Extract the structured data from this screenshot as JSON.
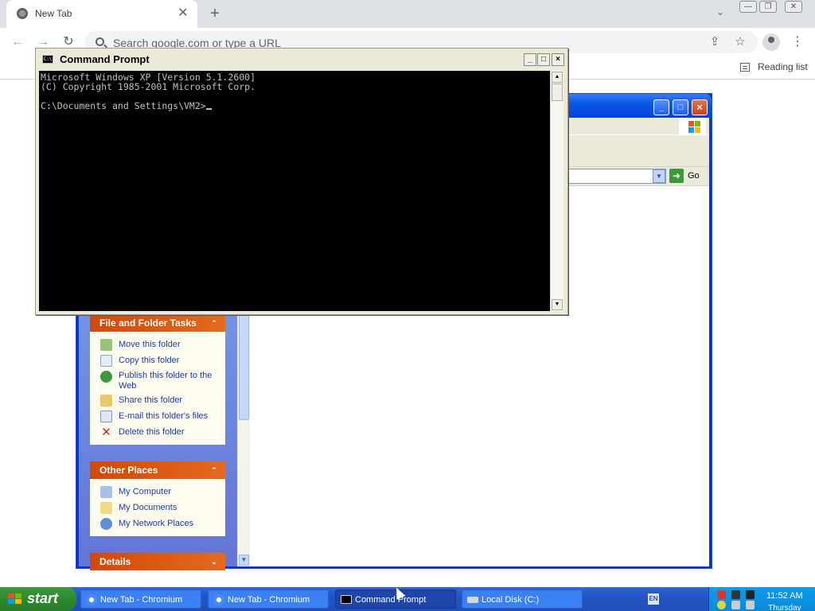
{
  "browser": {
    "tab_title": "New Tab",
    "tab_close": "✕",
    "new_tab": "+",
    "tab_search": "⌄",
    "omnibox_placeholder": "Search google.com or type a URL",
    "reading_list": "Reading list",
    "back": "←",
    "forward": "→",
    "reload": "↻",
    "share": "⇪",
    "bookmark_star": "☆",
    "menu": "⋮",
    "window_controls": [
      "—",
      "❐",
      "✕"
    ]
  },
  "cmd": {
    "title": "Command Prompt",
    "icon_text": "C:\\",
    "controls": [
      "_",
      "□",
      "×"
    ],
    "lines": [
      "Microsoft Windows XP [Version 5.1.2600]",
      "(C) Copyright 1985-2001 Microsoft Corp.",
      "",
      "C:\\Documents and Settings\\VM2>"
    ]
  },
  "explorer": {
    "controls": [
      "_",
      "□",
      "×"
    ],
    "go_label": "Go",
    "panes": {
      "file_folder_tasks": {
        "title": "File and Folder Tasks",
        "items": [
          "Move this folder",
          "Copy this folder",
          "Publish this folder to the Web",
          "Share this folder",
          "E-mail this folder's files",
          "Delete this folder"
        ]
      },
      "other_places": {
        "title": "Other Places",
        "items": [
          "My Computer",
          "My Documents",
          "My Network Places"
        ]
      },
      "details": {
        "title": "Details"
      }
    }
  },
  "taskbar": {
    "start": "start",
    "buttons": [
      "New Tab - Chromium",
      "New Tab - Chromium",
      "Command Prompt",
      "Local Disk (C:)"
    ],
    "lang": "EN",
    "clock": "11:52 AM",
    "day": "Thursday"
  },
  "colors": {
    "xp_blue": "#0831d9",
    "task_orange": "#d34808",
    "taskbar_blue": "#2457c4",
    "start_green": "#2d8a2d"
  }
}
